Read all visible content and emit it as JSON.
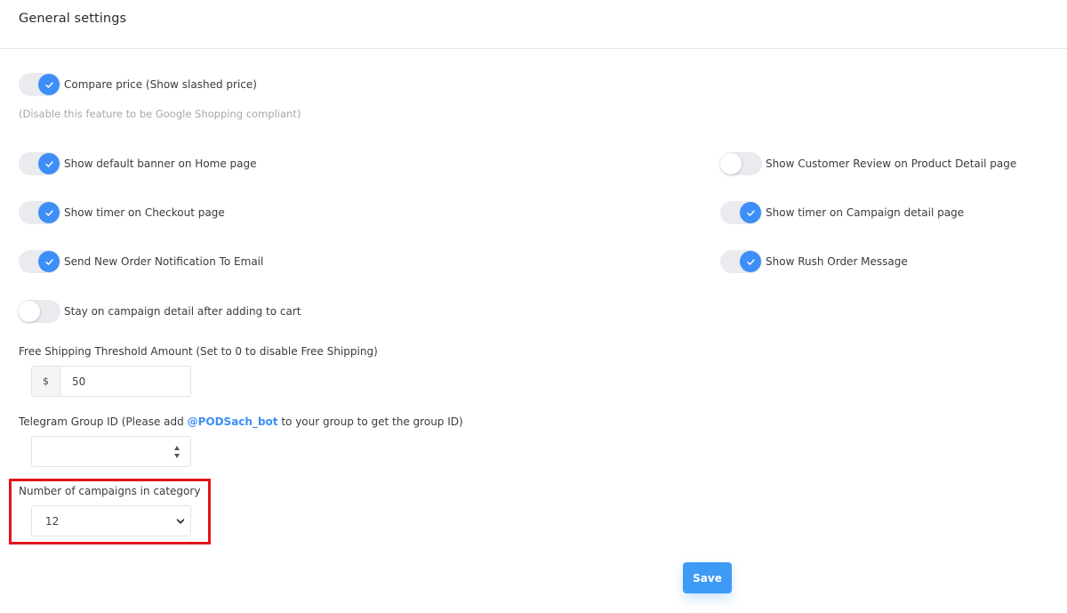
{
  "header": {
    "title": "General settings"
  },
  "toggles": {
    "compare_price": {
      "label": "Compare price (Show slashed price)",
      "on": true
    },
    "default_banner": {
      "label": "Show default banner on Home page",
      "on": true
    },
    "customer_review": {
      "label": "Show Customer Review on Product Detail page",
      "on": false
    },
    "timer_checkout": {
      "label": "Show timer on Checkout page",
      "on": true
    },
    "timer_campaign": {
      "label": "Show timer on Campaign detail page",
      "on": true
    },
    "order_notification": {
      "label": "Send New Order Notification To Email",
      "on": true
    },
    "rush_order": {
      "label": "Show Rush Order Message",
      "on": true
    },
    "stay_on_campaign": {
      "label": "Stay on campaign detail after adding to cart",
      "on": false
    }
  },
  "compare_price_hint": "(Disable this feature to be Google Shopping compliant)",
  "free_shipping": {
    "label": "Free Shipping Threshold Amount (Set to 0 to disable Free Shipping)",
    "prefix": "$",
    "value": "50"
  },
  "telegram": {
    "label_before": "Telegram Group ID (Please add ",
    "link": "@PODSach_bot",
    "label_after": " to your group to get the group ID)",
    "value": ""
  },
  "campaigns_per_category": {
    "label": "Number of campaigns in category",
    "selected": "12"
  },
  "save_button": {
    "label": "Save"
  },
  "colors": {
    "accent": "#3d8ef8",
    "save": "#3d9bf6",
    "highlight": "#e3141b",
    "hint": "#a7a7ad"
  },
  "icons": {
    "toggle_on": "check-icon",
    "select": "chevron-down-icon",
    "number": "spinner-arrows-icon"
  }
}
